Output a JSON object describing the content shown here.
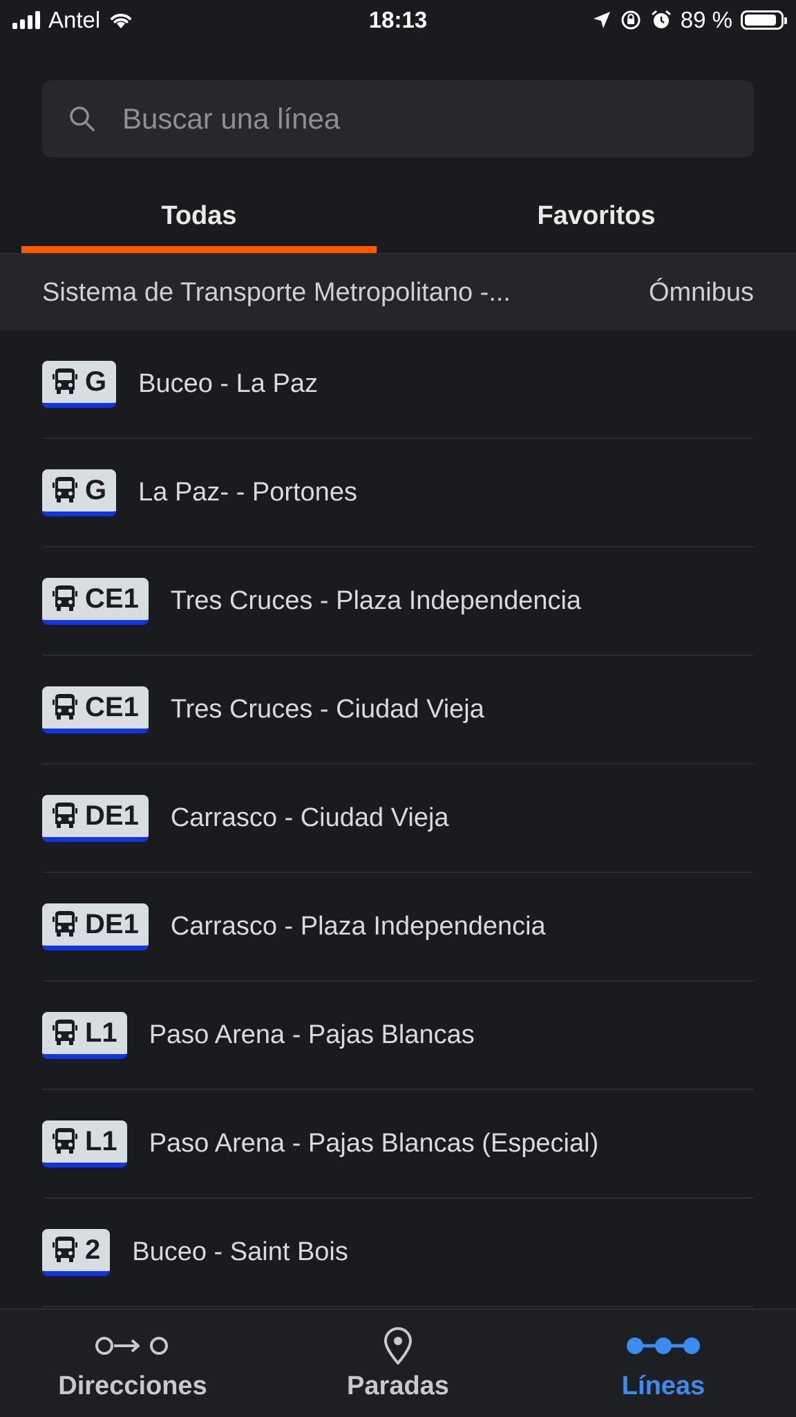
{
  "status_bar": {
    "carrier": "Antel",
    "time": "18:13",
    "battery_percent": "89 %",
    "battery_level": 0.89
  },
  "search": {
    "placeholder": "Buscar una línea"
  },
  "tabs": [
    {
      "label": "Todas",
      "selected": true
    },
    {
      "label": "Favoritos",
      "selected": false
    }
  ],
  "section": {
    "title": "Sistema de Transporte Metropolitano -...",
    "type": "Ómnibus"
  },
  "lines": [
    {
      "code": "G",
      "name": "Buceo - La Paz"
    },
    {
      "code": "G",
      "name": "La Paz- - Portones"
    },
    {
      "code": "CE1",
      "name": "Tres Cruces - Plaza Independencia"
    },
    {
      "code": "CE1",
      "name": "Tres Cruces - Ciudad Vieja"
    },
    {
      "code": "DE1",
      "name": "Carrasco - Ciudad Vieja"
    },
    {
      "code": "DE1",
      "name": "Carrasco - Plaza Independencia"
    },
    {
      "code": "L1",
      "name": "Paso Arena - Pajas Blancas"
    },
    {
      "code": "L1",
      "name": "Paso Arena - Pajas Blancas (Especial)"
    },
    {
      "code": "2",
      "name": "Buceo - Saint Bois"
    }
  ],
  "bottom_nav": [
    {
      "label": "Direcciones",
      "icon": "directions-icon",
      "active": false
    },
    {
      "label": "Paradas",
      "icon": "location-pin-icon",
      "active": false
    },
    {
      "label": "Líneas",
      "icon": "lines-icon",
      "active": true
    }
  ],
  "colors": {
    "background": "#1a1b1e",
    "accent_tab": "#ff5a00",
    "badge_underline": "#1135e0",
    "active_nav": "#3b8bf0"
  }
}
